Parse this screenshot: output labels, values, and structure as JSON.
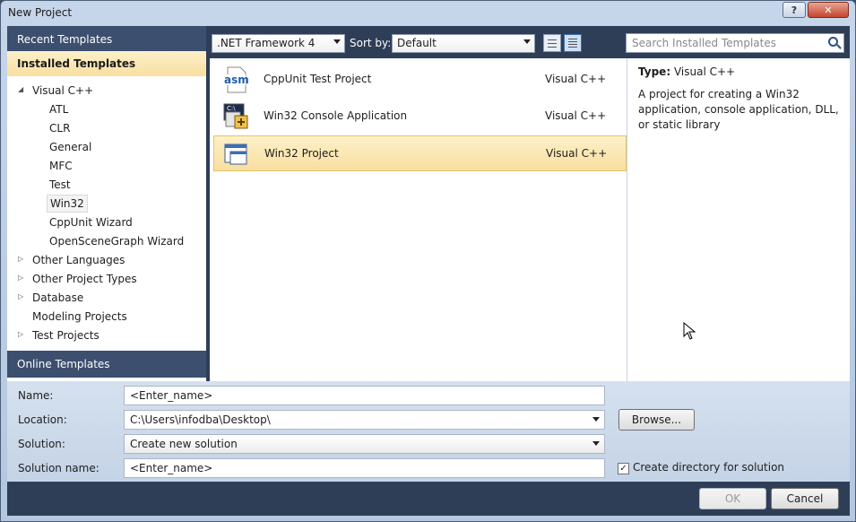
{
  "window": {
    "title": "New Project",
    "help_label": "?",
    "close_label": "✕"
  },
  "left": {
    "recent_label": "Recent Templates",
    "installed_label": "Installed Templates",
    "online_label": "Online Templates",
    "tree": [
      {
        "label": "Visual C++",
        "expander": "◢"
      },
      {
        "label": "ATL"
      },
      {
        "label": "CLR"
      },
      {
        "label": "General"
      },
      {
        "label": "MFC"
      },
      {
        "label": "Test"
      },
      {
        "label": "Win32"
      },
      {
        "label": "CppUnit Wizard"
      },
      {
        "label": "OpenSceneGraph Wizard"
      },
      {
        "label": "Other Languages",
        "expander": "▷"
      },
      {
        "label": "Other Project Types",
        "expander": "▷"
      },
      {
        "label": "Database",
        "expander": "▷"
      },
      {
        "label": "Modeling Projects"
      },
      {
        "label": "Test Projects",
        "expander": "▷"
      }
    ]
  },
  "toolbar": {
    "framework": ".NET Framework 4",
    "sort_label": "Sort by:",
    "sort_value": "Default",
    "search_placeholder": "Search Installed Templates"
  },
  "templates": [
    {
      "name": "CppUnit Test Project",
      "lang": "Visual C++",
      "icon_text": "asm"
    },
    {
      "name": "Win32 Console Application",
      "lang": "Visual C++",
      "icon_text": "C:\\"
    },
    {
      "name": "Win32 Project",
      "lang": "Visual C++",
      "icon_text": ""
    }
  ],
  "details": {
    "type_label": "Type:",
    "type_value": "Visual C++",
    "description": "A project for creating a Win32 application, console application, DLL, or static library"
  },
  "form": {
    "name_label": "Name:",
    "name_value": "<Enter_name>",
    "location_label": "Location:",
    "location_value": "C:\\Users\\infodba\\Desktop\\",
    "browse_label": "Browse...",
    "solution_label": "Solution:",
    "solution_value": "Create new solution",
    "solution_name_label": "Solution name:",
    "solution_name_value": "<Enter_name>",
    "create_dir_label": "Create directory for solution",
    "create_dir_checked": "✓"
  },
  "buttons": {
    "ok_label": "OK",
    "cancel_label": "Cancel"
  }
}
